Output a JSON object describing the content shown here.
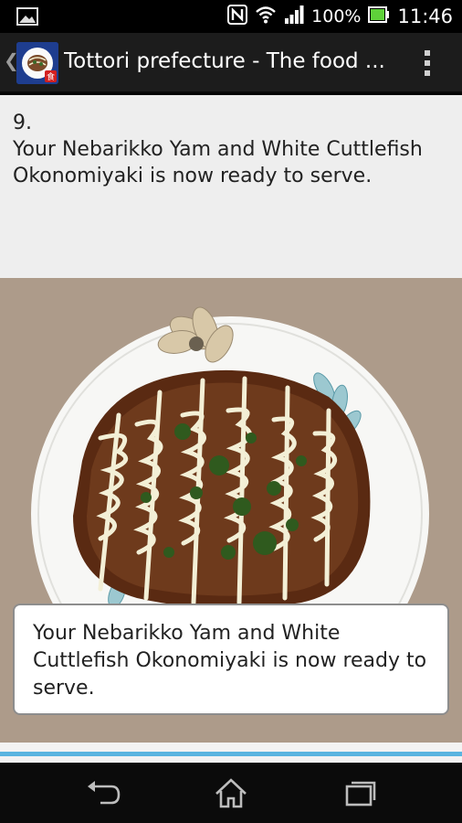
{
  "status_bar": {
    "battery": "100%",
    "time": "11:46",
    "icons": [
      "gallery-notification-icon",
      "nfc-icon",
      "wifi-icon",
      "signal-icon",
      "battery-icon"
    ]
  },
  "action_bar": {
    "title": "Tottori prefecture - The food ...",
    "icons": [
      "up-caret-icon",
      "app-icon",
      "overflow-menu-icon"
    ]
  },
  "content": {
    "step_number": "9.",
    "step_text": "Your Nebarikko Yam and White Cuttlefish Okonomiyaki is now ready to serve.",
    "caption": "Your Nebarikko Yam and White Cuttlefish Okonomiyaki is now ready to serve."
  },
  "nav_bar": {
    "icons": [
      "back-icon",
      "home-icon",
      "recent-apps-icon"
    ]
  },
  "colors": {
    "status_bar": "#000000",
    "action_bar": "#1c1c1c",
    "content_bg": "#eeeeee",
    "photo_bg": "#ad9b8a",
    "accent_line": "#5ab4e0",
    "battery": "#5fd13a"
  }
}
